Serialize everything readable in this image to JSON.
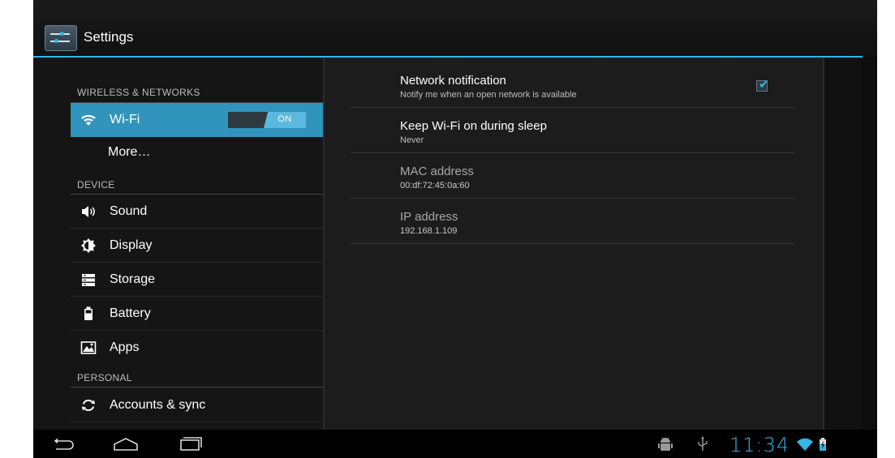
{
  "app": {
    "title": "Settings",
    "accent_color": "#33b5e5"
  },
  "sidebar": {
    "sections": [
      {
        "header": "WIRELESS & NETWORKS"
      },
      {
        "header": "DEVICE"
      },
      {
        "header": "PERSONAL"
      }
    ],
    "items": [
      {
        "label": "Wi-Fi",
        "icon": "wifi-icon",
        "selected": true,
        "toggle": "ON"
      },
      {
        "label": "More…",
        "icon": ""
      },
      {
        "label": "Sound",
        "icon": "speaker-icon"
      },
      {
        "label": "Display",
        "icon": "brightness-icon"
      },
      {
        "label": "Storage",
        "icon": "storage-icon"
      },
      {
        "label": "Battery",
        "icon": "battery-icon"
      },
      {
        "label": "Apps",
        "icon": "apps-icon"
      },
      {
        "label": "Accounts & sync",
        "icon": "sync-icon"
      }
    ]
  },
  "detail": {
    "rows": [
      {
        "title": "Network notification",
        "summary": "Notify me when an open network is available",
        "checked": true
      },
      {
        "title": "Keep Wi-Fi on during sleep",
        "summary": "Never"
      },
      {
        "title": "MAC address",
        "summary": "00:df:72:45:0a:60",
        "enabled": false
      },
      {
        "title": "IP address",
        "summary": "192.168.1.109",
        "enabled": false
      }
    ]
  },
  "system_bar": {
    "clock": "11:34",
    "nav_icons": [
      "back-icon",
      "home-icon",
      "recent-apps-icon"
    ],
    "status_icons": [
      "android-debug-icon",
      "usb-icon",
      "wifi-signal-icon",
      "battery-charging-icon"
    ]
  }
}
